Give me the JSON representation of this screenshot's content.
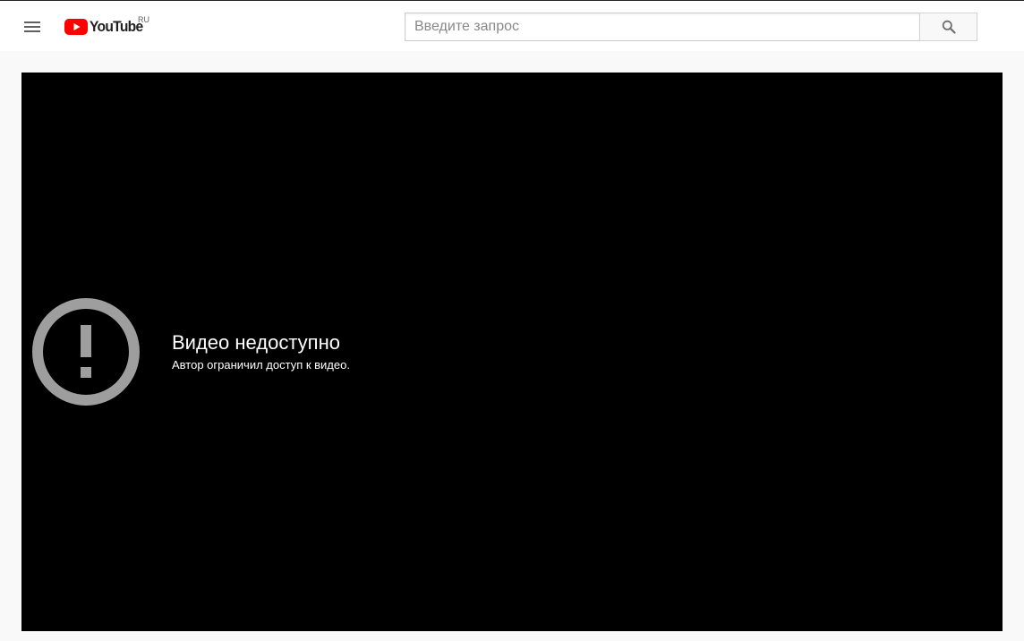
{
  "header": {
    "logo_text": "YouTube",
    "country_code": "RU",
    "search_placeholder": "Введите запрос",
    "search_value": ""
  },
  "player": {
    "error_title": "Видео недоступно",
    "error_subtitle": "Автор ограничил доступ к видео."
  },
  "icons": {
    "menu": "hamburger-menu-icon",
    "logo": "youtube-play-icon",
    "search": "magnifier-icon",
    "error": "exclamation-circle-icon"
  },
  "colors": {
    "brand_red": "#ff0000",
    "page_bg": "#f9f9f9",
    "player_bg": "#000000",
    "error_icon": "#9e9e9e"
  }
}
